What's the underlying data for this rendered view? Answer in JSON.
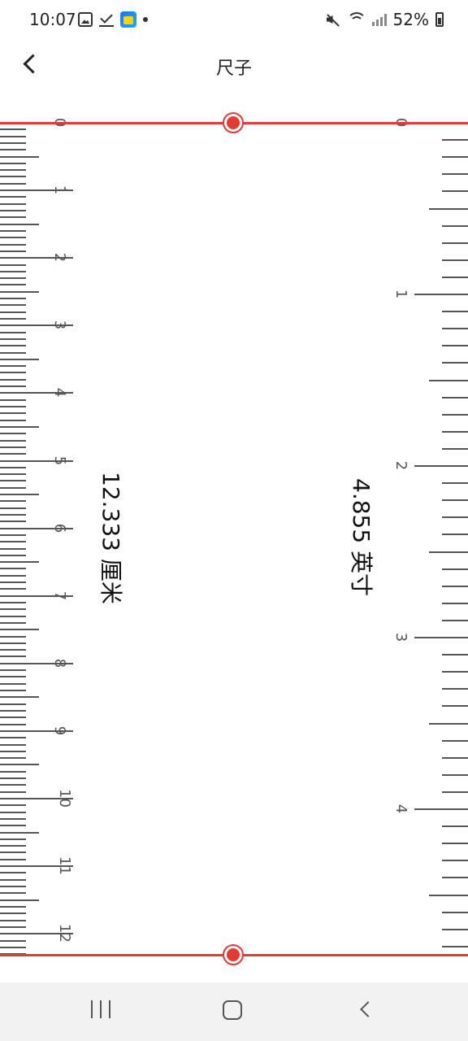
{
  "status_bar": {
    "time": "10:07",
    "battery": "52%"
  },
  "app_bar": {
    "title": "尺子"
  },
  "ruler": {
    "cm_labels": [
      "0",
      "1",
      "2",
      "3",
      "4",
      "5",
      "6",
      "7",
      "8",
      "9",
      "10",
      "11",
      "12"
    ],
    "inch_labels": [
      "0",
      "1",
      "2",
      "3",
      "4"
    ],
    "cm_measurement": "12.333 厘米",
    "inch_measurement": "4.855 英寸"
  },
  "colors": {
    "accent": "#e53935"
  }
}
